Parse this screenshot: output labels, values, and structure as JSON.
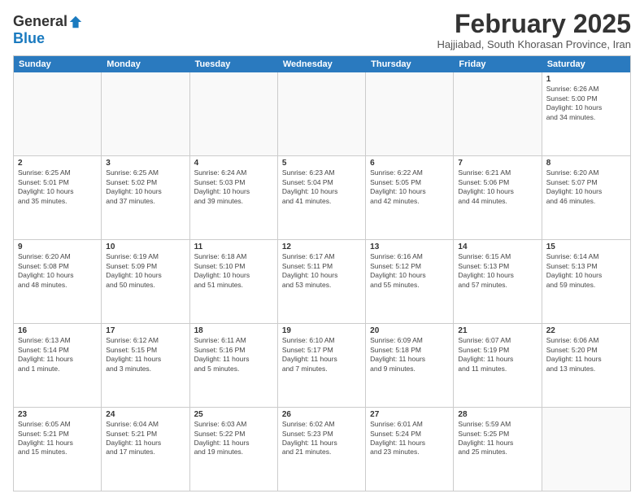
{
  "logo": {
    "general": "General",
    "blue": "Blue"
  },
  "title": "February 2025",
  "subtitle": "Hajjiabad, South Khorasan Province, Iran",
  "headers": [
    "Sunday",
    "Monday",
    "Tuesday",
    "Wednesday",
    "Thursday",
    "Friday",
    "Saturday"
  ],
  "weeks": [
    [
      {
        "day": "",
        "info": ""
      },
      {
        "day": "",
        "info": ""
      },
      {
        "day": "",
        "info": ""
      },
      {
        "day": "",
        "info": ""
      },
      {
        "day": "",
        "info": ""
      },
      {
        "day": "",
        "info": ""
      },
      {
        "day": "1",
        "info": "Sunrise: 6:26 AM\nSunset: 5:00 PM\nDaylight: 10 hours\nand 34 minutes."
      }
    ],
    [
      {
        "day": "2",
        "info": "Sunrise: 6:25 AM\nSunset: 5:01 PM\nDaylight: 10 hours\nand 35 minutes."
      },
      {
        "day": "3",
        "info": "Sunrise: 6:25 AM\nSunset: 5:02 PM\nDaylight: 10 hours\nand 37 minutes."
      },
      {
        "day": "4",
        "info": "Sunrise: 6:24 AM\nSunset: 5:03 PM\nDaylight: 10 hours\nand 39 minutes."
      },
      {
        "day": "5",
        "info": "Sunrise: 6:23 AM\nSunset: 5:04 PM\nDaylight: 10 hours\nand 41 minutes."
      },
      {
        "day": "6",
        "info": "Sunrise: 6:22 AM\nSunset: 5:05 PM\nDaylight: 10 hours\nand 42 minutes."
      },
      {
        "day": "7",
        "info": "Sunrise: 6:21 AM\nSunset: 5:06 PM\nDaylight: 10 hours\nand 44 minutes."
      },
      {
        "day": "8",
        "info": "Sunrise: 6:20 AM\nSunset: 5:07 PM\nDaylight: 10 hours\nand 46 minutes."
      }
    ],
    [
      {
        "day": "9",
        "info": "Sunrise: 6:20 AM\nSunset: 5:08 PM\nDaylight: 10 hours\nand 48 minutes."
      },
      {
        "day": "10",
        "info": "Sunrise: 6:19 AM\nSunset: 5:09 PM\nDaylight: 10 hours\nand 50 minutes."
      },
      {
        "day": "11",
        "info": "Sunrise: 6:18 AM\nSunset: 5:10 PM\nDaylight: 10 hours\nand 51 minutes."
      },
      {
        "day": "12",
        "info": "Sunrise: 6:17 AM\nSunset: 5:11 PM\nDaylight: 10 hours\nand 53 minutes."
      },
      {
        "day": "13",
        "info": "Sunrise: 6:16 AM\nSunset: 5:12 PM\nDaylight: 10 hours\nand 55 minutes."
      },
      {
        "day": "14",
        "info": "Sunrise: 6:15 AM\nSunset: 5:13 PM\nDaylight: 10 hours\nand 57 minutes."
      },
      {
        "day": "15",
        "info": "Sunrise: 6:14 AM\nSunset: 5:13 PM\nDaylight: 10 hours\nand 59 minutes."
      }
    ],
    [
      {
        "day": "16",
        "info": "Sunrise: 6:13 AM\nSunset: 5:14 PM\nDaylight: 11 hours\nand 1 minute."
      },
      {
        "day": "17",
        "info": "Sunrise: 6:12 AM\nSunset: 5:15 PM\nDaylight: 11 hours\nand 3 minutes."
      },
      {
        "day": "18",
        "info": "Sunrise: 6:11 AM\nSunset: 5:16 PM\nDaylight: 11 hours\nand 5 minutes."
      },
      {
        "day": "19",
        "info": "Sunrise: 6:10 AM\nSunset: 5:17 PM\nDaylight: 11 hours\nand 7 minutes."
      },
      {
        "day": "20",
        "info": "Sunrise: 6:09 AM\nSunset: 5:18 PM\nDaylight: 11 hours\nand 9 minutes."
      },
      {
        "day": "21",
        "info": "Sunrise: 6:07 AM\nSunset: 5:19 PM\nDaylight: 11 hours\nand 11 minutes."
      },
      {
        "day": "22",
        "info": "Sunrise: 6:06 AM\nSunset: 5:20 PM\nDaylight: 11 hours\nand 13 minutes."
      }
    ],
    [
      {
        "day": "23",
        "info": "Sunrise: 6:05 AM\nSunset: 5:21 PM\nDaylight: 11 hours\nand 15 minutes."
      },
      {
        "day": "24",
        "info": "Sunrise: 6:04 AM\nSunset: 5:21 PM\nDaylight: 11 hours\nand 17 minutes."
      },
      {
        "day": "25",
        "info": "Sunrise: 6:03 AM\nSunset: 5:22 PM\nDaylight: 11 hours\nand 19 minutes."
      },
      {
        "day": "26",
        "info": "Sunrise: 6:02 AM\nSunset: 5:23 PM\nDaylight: 11 hours\nand 21 minutes."
      },
      {
        "day": "27",
        "info": "Sunrise: 6:01 AM\nSunset: 5:24 PM\nDaylight: 11 hours\nand 23 minutes."
      },
      {
        "day": "28",
        "info": "Sunrise: 5:59 AM\nSunset: 5:25 PM\nDaylight: 11 hours\nand 25 minutes."
      },
      {
        "day": "",
        "info": ""
      }
    ]
  ]
}
